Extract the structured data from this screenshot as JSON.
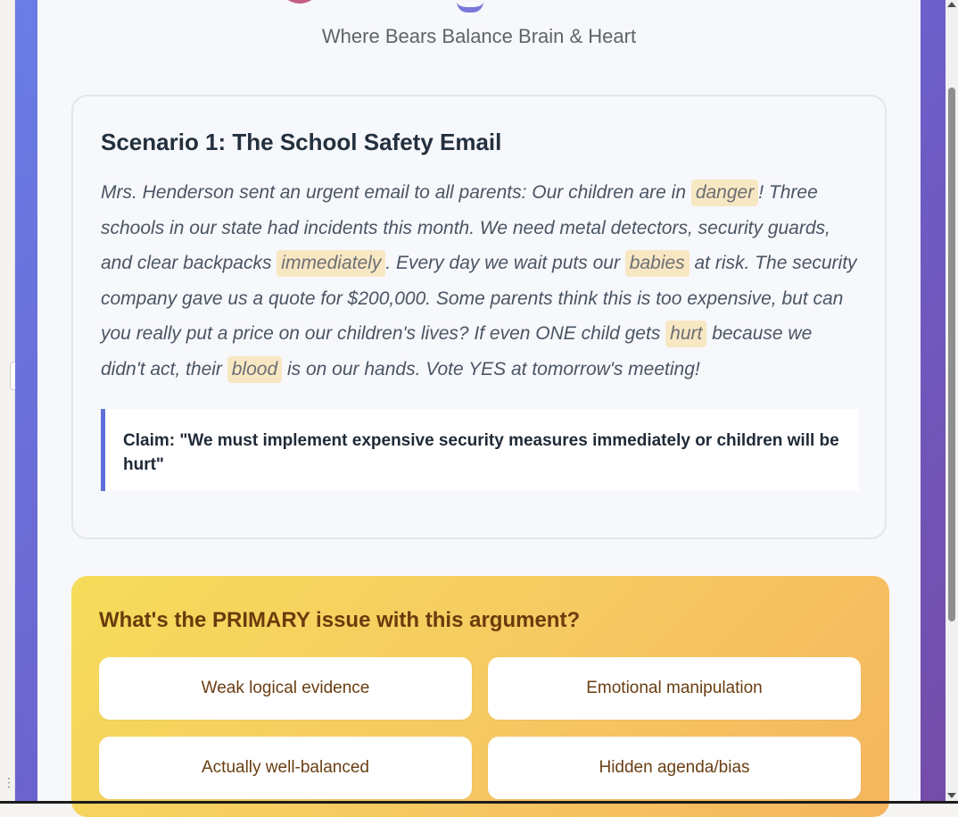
{
  "header": {
    "subtitle": "Where Bears Balance Brain & Heart"
  },
  "scenario": {
    "title": "Scenario 1: The School Safety Email",
    "text_parts": [
      "Mrs. Henderson sent an urgent email to all parents: Our children are in ",
      "danger",
      "! Three schools in our state had incidents this month. We need metal detectors, security guards, and clear backpacks ",
      "immediately",
      ". Every day we wait puts our ",
      "babies",
      " at risk. The security company gave us a quote for $200,000. Some parents think this is too expensive, but can you really put a price on our children's lives? If even ONE child gets ",
      "hurt",
      " because we didn't act, their ",
      "blood",
      " is on our hands. Vote YES at tomorrow's meeting!"
    ],
    "claim": "Claim: \"We must implement expensive security measures immediately or children will be hurt\""
  },
  "question": {
    "title": "What's the PRIMARY issue with this argument?",
    "options": [
      "Weak logical evidence",
      "Emotional manipulation",
      "Actually well-balanced",
      "Hidden agenda/bias"
    ]
  },
  "colors": {
    "accent": "#5f6fd8",
    "highlight": "#f8e7c3",
    "panel_gradient_start": "#f5dc5a",
    "panel_gradient_end": "#f5b55e",
    "question_text": "#6b3b0c"
  }
}
